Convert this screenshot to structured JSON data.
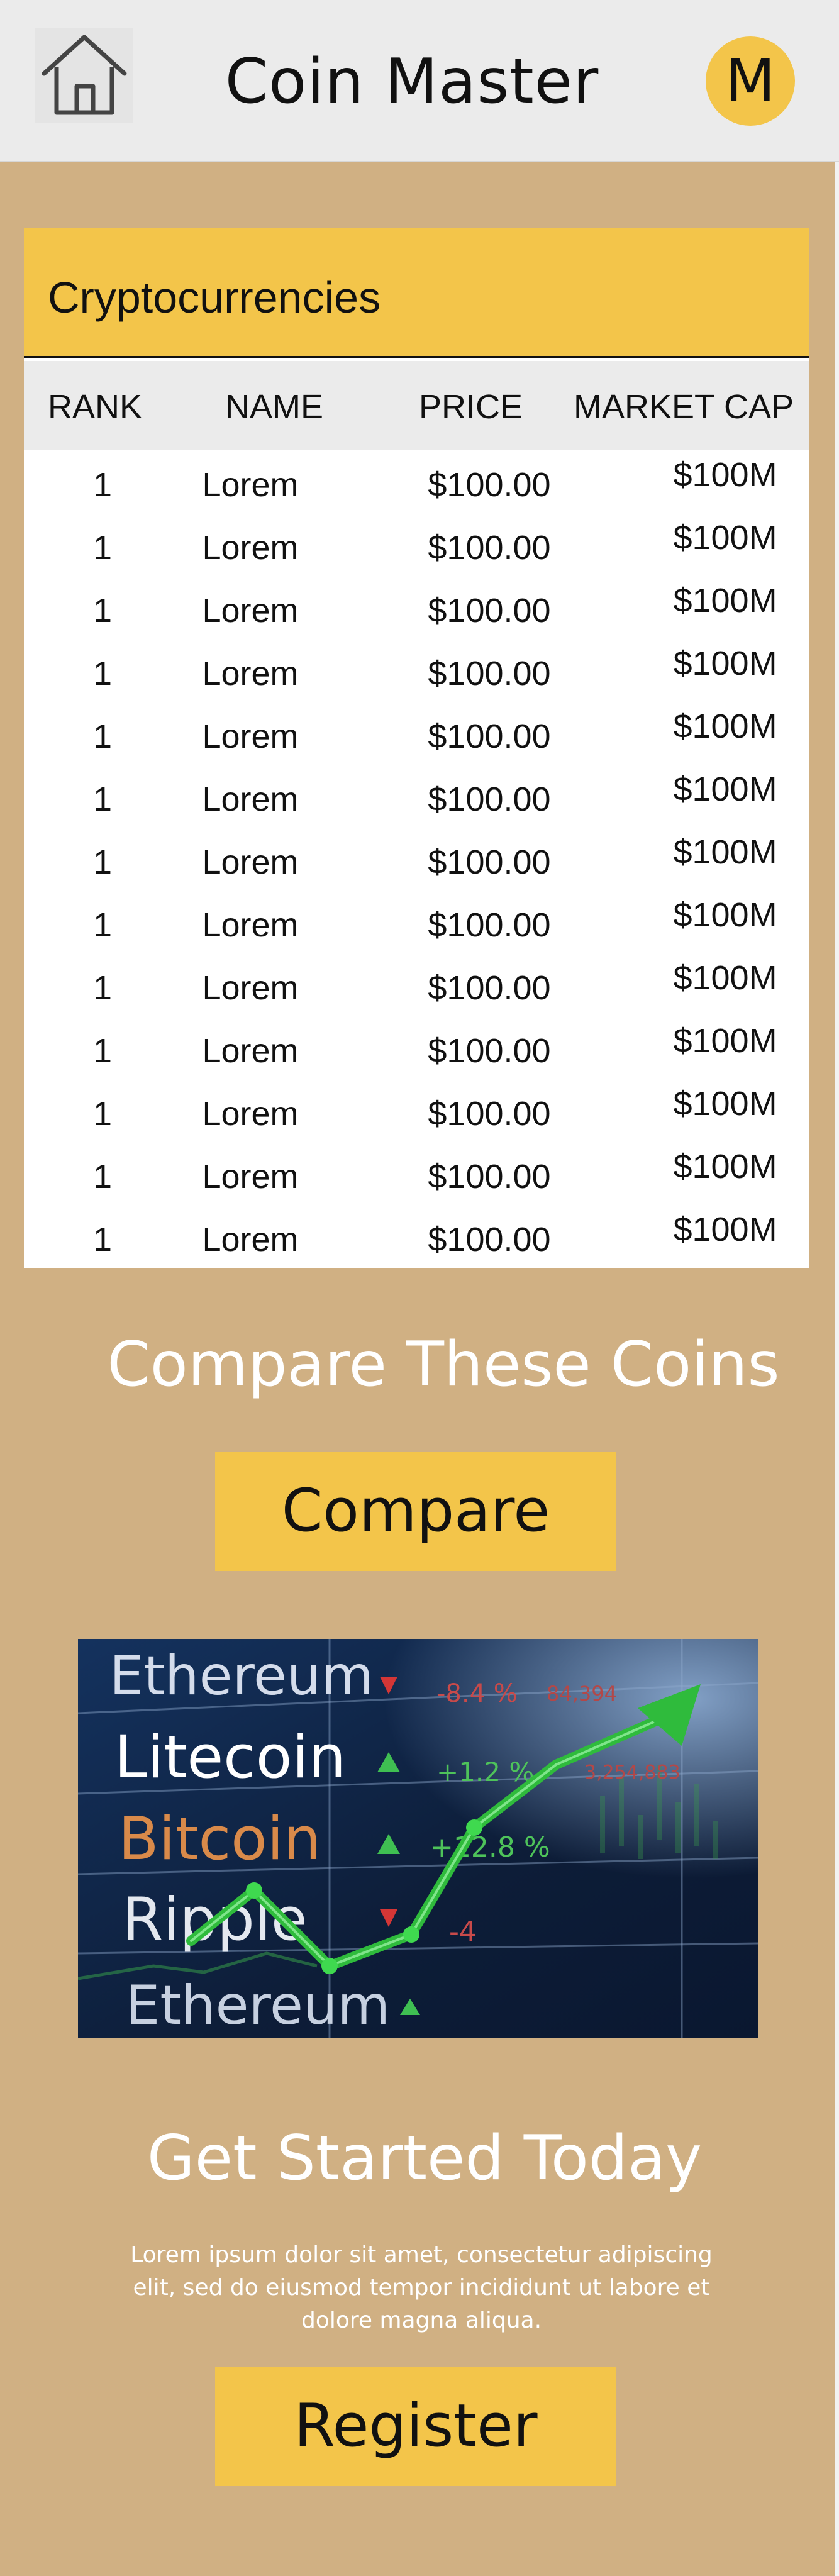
{
  "header": {
    "title": "Coin Master",
    "avatar_initial": "M",
    "home_icon": "house-icon"
  },
  "crypto": {
    "title": "Cryptocurrencies",
    "columns": [
      "RANK",
      "NAME",
      "PRICE",
      "MARKET CAP"
    ],
    "rows": [
      {
        "rank": "1",
        "name": "Lorem",
        "price": "$100.00",
        "cap": "$100M"
      },
      {
        "rank": "1",
        "name": "Lorem",
        "price": "$100.00",
        "cap": "$100M"
      },
      {
        "rank": "1",
        "name": "Lorem",
        "price": "$100.00",
        "cap": "$100M"
      },
      {
        "rank": "1",
        "name": "Lorem",
        "price": "$100.00",
        "cap": "$100M"
      },
      {
        "rank": "1",
        "name": "Lorem",
        "price": "$100.00",
        "cap": "$100M"
      },
      {
        "rank": "1",
        "name": "Lorem",
        "price": "$100.00",
        "cap": "$100M"
      },
      {
        "rank": "1",
        "name": "Lorem",
        "price": "$100.00",
        "cap": "$100M"
      },
      {
        "rank": "1",
        "name": "Lorem",
        "price": "$100.00",
        "cap": "$100M"
      },
      {
        "rank": "1",
        "name": "Lorem",
        "price": "$100.00",
        "cap": "$100M"
      },
      {
        "rank": "1",
        "name": "Lorem",
        "price": "$100.00",
        "cap": "$100M"
      },
      {
        "rank": "1",
        "name": "Lorem",
        "price": "$100.00",
        "cap": "$100M"
      },
      {
        "rank": "1",
        "name": "Lorem",
        "price": "$100.00",
        "cap": "$100M"
      },
      {
        "rank": "1",
        "name": "Lorem",
        "price": "$100.00",
        "cap": "$100M"
      }
    ]
  },
  "compare": {
    "heading": "Compare These Coins",
    "button_label": "Compare"
  },
  "hero_image": {
    "coins": [
      "Ethereum",
      "Litecoin",
      "Bitcoin",
      "Ripple",
      "Ethereum"
    ],
    "changes": [
      "-8.4 %",
      "+1.2 %",
      "+12.8 %",
      "-4",
      ""
    ],
    "numbers": [
      "84,394",
      "3,254,883"
    ]
  },
  "started": {
    "heading": "Get Started Today",
    "body": "Lorem ipsum dolor sit amet, consectetur adipiscing elit, sed do eiusmod tempor incididunt ut labore et dolore magna aliqua.",
    "button_label": "Register"
  },
  "colors": {
    "background": "#d0b083",
    "accent": "#f3c54a",
    "header_bg": "#ebebeb"
  }
}
